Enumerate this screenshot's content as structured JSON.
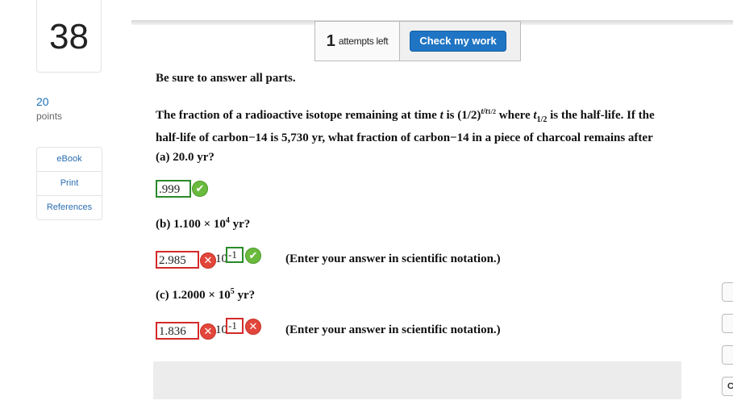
{
  "question": {
    "number": "38",
    "points": "20",
    "points_label": "points"
  },
  "tools": [
    "eBook",
    "Print",
    "References"
  ],
  "attempts": {
    "count": "1",
    "label": "attempts left"
  },
  "check_button": "Check my work",
  "instructions": "Be sure to answer all parts.",
  "problem": {
    "part1": "The fraction of a radioactive isotope remaining at time ",
    "t": "t",
    "part2": " is (1/2)",
    "exp_t": "t",
    "exp_slash": "/",
    "exp_t2": "t",
    "exp_sub": "1/2",
    "part3": " where ",
    "t_half": "t",
    "half_sub": "1/2",
    "part4": " is the half-life. If the half-life of carbon−14 is 5,730 yr, what fraction of carbon−14 in a piece of charcoal remains after"
  },
  "parts": {
    "a": {
      "label": "(a) 20.0 yr?",
      "answer": ".999",
      "status": "correct"
    },
    "b": {
      "label_pre": "(b) 1.100 × 10",
      "label_exp": "4",
      "label_post": " yr?",
      "answer": "2.985",
      "answer_status": "incorrect",
      "ten": "10",
      "exponent": "-1",
      "exponent_status": "correct",
      "note": "(Enter your answer in scientific notation.)"
    },
    "c": {
      "label_pre": "(c) 1.2000 × 10",
      "label_exp": "5",
      "label_post": " yr?",
      "answer": "1.836",
      "answer_status": "incorrect",
      "ten": "10",
      "exponent": "-1",
      "exponent_status": "incorrect",
      "note": "(Enter your answer in scientific notation.)"
    }
  },
  "icons": {
    "correct": "✔",
    "incorrect": "✕"
  },
  "side_buttons": [
    "",
    "",
    "",
    "",
    "C"
  ],
  "colors": {
    "correct_border": "#2a8a2a",
    "incorrect_border": "#d42a2a",
    "accent": "#1f75c4"
  }
}
